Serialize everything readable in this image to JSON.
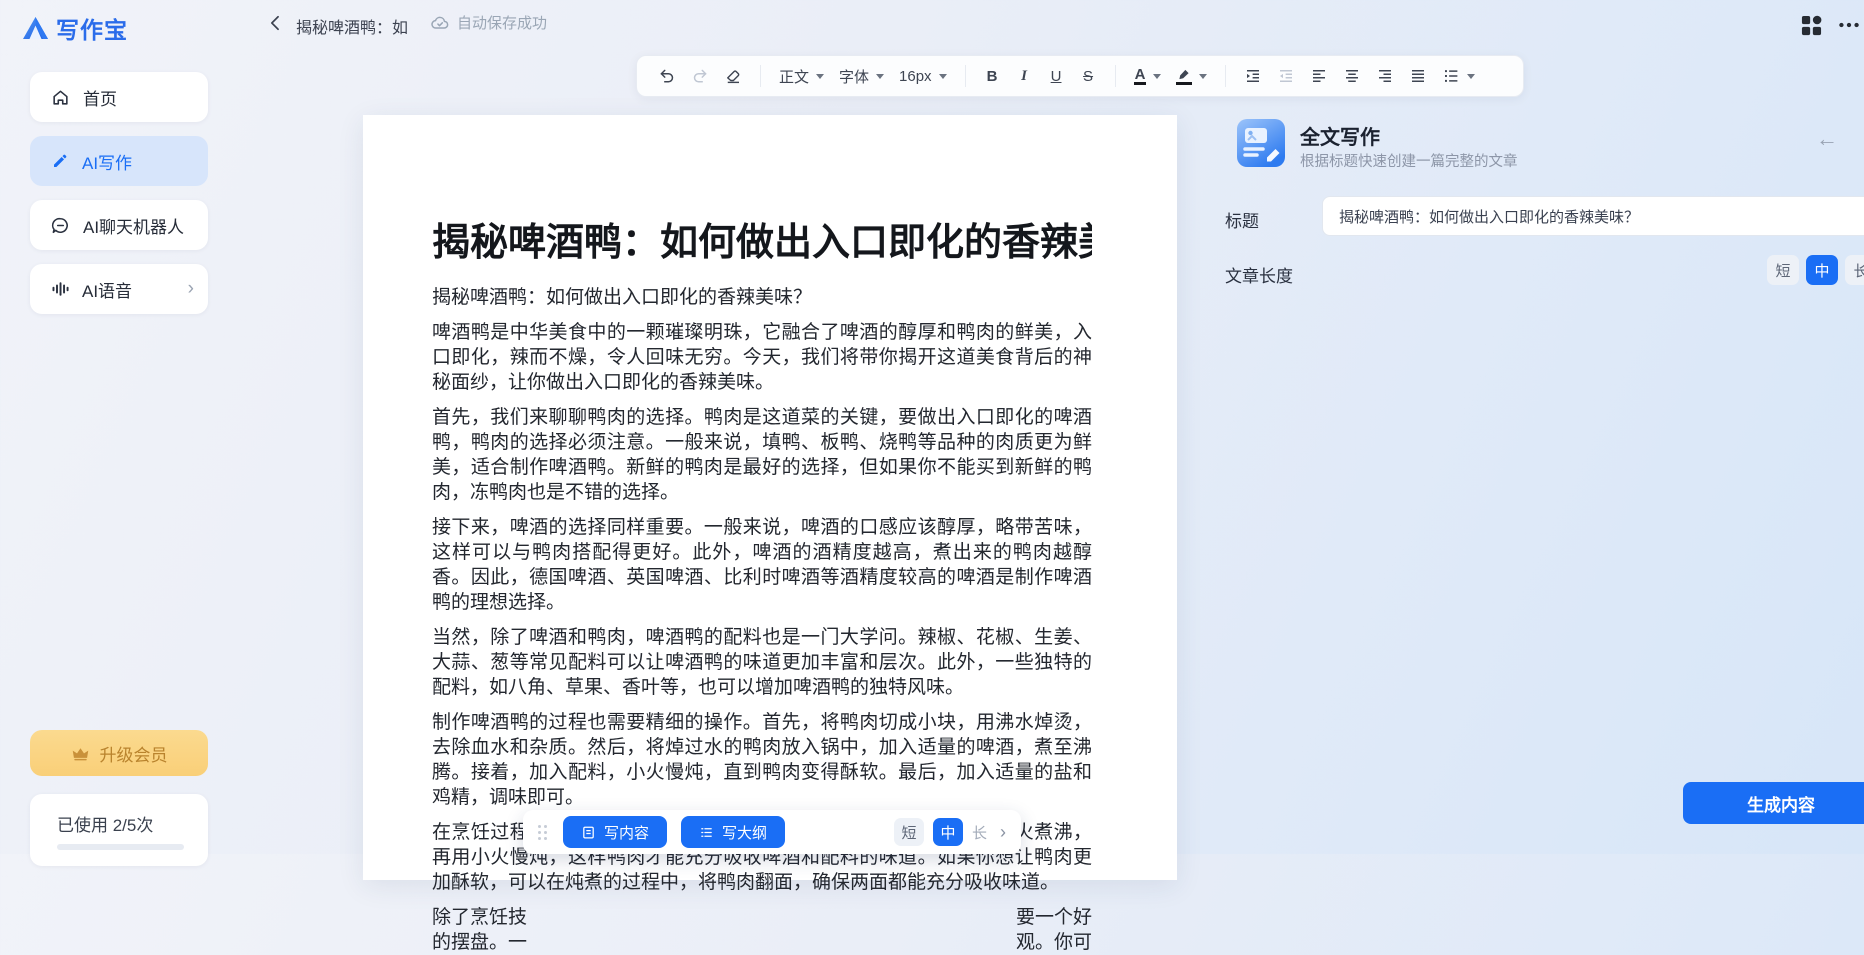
{
  "header": {
    "logo_text": "写作宝",
    "doc_title": "揭秘啤酒鸭：如",
    "autosave_status": "自动保存成功"
  },
  "sidebar": {
    "items": [
      {
        "label": "首页"
      },
      {
        "label": "AI写作"
      },
      {
        "label": "AI聊天机器人"
      },
      {
        "label": "AI语音"
      }
    ],
    "upgrade_label": "升级会员",
    "usage_text": "已使用 2/5次"
  },
  "toolbar": {
    "style_selector": "正文",
    "font_selector": "字体",
    "size_selector": "16px",
    "bold": "B",
    "italic": "I",
    "underline": "U",
    "strikethrough": "S",
    "color_letter": "A"
  },
  "document": {
    "title": "揭秘啤酒鸭：如何做出入口即化的香辣美味",
    "paragraphs": [
      "揭秘啤酒鸭：如何做出入口即化的香辣美味？",
      "啤酒鸭是中华美食中的一颗璀璨明珠，它融合了啤酒的醇厚和鸭肉的鲜美，入口即化，辣而不燥，令人回味无穷。今天，我们将带你揭开这道美食背后的神秘面纱，让你做出入口即化的香辣美味。",
      "首先，我们来聊聊鸭肉的选择。鸭肉是这道菜的关键，要做出入口即化的啤酒鸭，鸭肉的选择必须注意。一般来说，填鸭、板鸭、烧鸭等品种的肉质更为鲜美，适合制作啤酒鸭。新鲜的鸭肉是最好的选择，但如果你不能买到新鲜的鸭肉，冻鸭肉也是不错的选择。",
      "接下来，啤酒的选择同样重要。一般来说，啤酒的口感应该醇厚，略带苦味，这样可以与鸭肉搭配得更好。此外，啤酒的酒精度越高，煮出来的鸭肉越醇香。因此，德国啤酒、英国啤酒、比利时啤酒等酒精度较高的啤酒是制作啤酒鸭的理想选择。",
      "当然，除了啤酒和鸭肉，啤酒鸭的配料也是一门大学问。辣椒、花椒、生姜、大蒜、葱等常见配料可以让啤酒鸭的味道更加丰富和层次。此外，一些独特的配料，如八角、草果、香叶等，也可以增加啤酒鸭的独特风味。",
      "制作啤酒鸭的过程也需要精细的操作。首先，将鸭肉切成小块，用沸水焯烫，去除血水和杂质。然后，将焯过水的鸭肉放入锅中，加入适量的啤酒，煮至沸腾。接着，加入配料，小火慢炖，直到鸭肉变得酥软。最后，加入适量的盐和鸡精，调味即可。",
      "在烹饪过程中，火候的控制同样重要。一般来说，啤酒鸭需要先用大火煮沸，再用小火慢炖，这样鸭肉才能充分吸收啤酒和配料的味道。如果你想让鸭肉更加酥软，可以在炖煮的过程中，将鸭肉翻面，确保两面都能充分吸收味道。"
    ],
    "partial": {
      "line1_left": "除了烹饪技",
      "line1_right": "要一个好",
      "line2_left": "的摆盘。一",
      "line2_right": "观。你可"
    }
  },
  "floating_bar": {
    "write_content_label": "写内容",
    "write_outline_label": "写大纲",
    "length_options": [
      "短",
      "中",
      "长"
    ],
    "selected_length": "中"
  },
  "panel": {
    "title": "全文写作",
    "subtitle": "根据标题快速创建一篇完整的文章",
    "title_label": "标题",
    "title_value": "揭秘啤酒鸭：如何做出入口即化的香辣美味？",
    "length_label": "文章长度",
    "length_options": [
      "短",
      "中",
      "长"
    ],
    "selected_length": "中",
    "generate_label": "生成内容"
  },
  "colors": {
    "accent_blue": "#1a6ef5",
    "logo_blue": "#2b6cea",
    "sidebar_active_bg": "#d7e5fb",
    "upgrade_bg": "#f9d485",
    "upgrade_text": "#b9832d",
    "muted_text": "#9aa6b5"
  }
}
